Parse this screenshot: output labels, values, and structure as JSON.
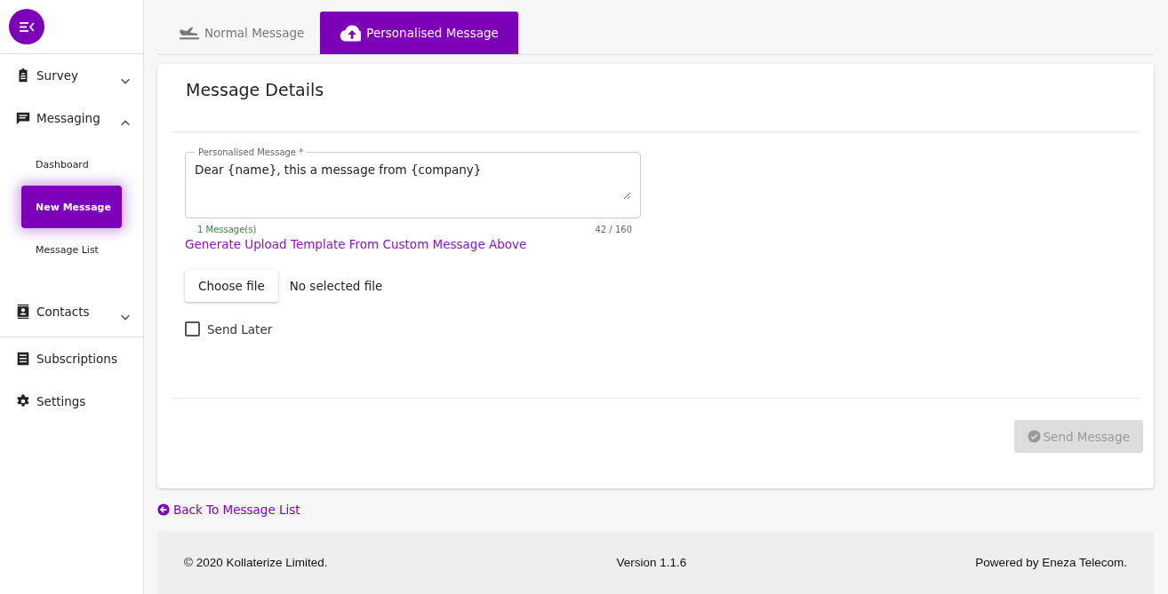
{
  "sidebar": {
    "items": [
      {
        "kind": "group",
        "label": "Survey",
        "expanded": false
      },
      {
        "kind": "group",
        "label": "Messaging",
        "expanded": true,
        "children": [
          {
            "label": "Dashboard",
            "selected": false
          },
          {
            "label": "New Message",
            "selected": true
          },
          {
            "label": "Message List",
            "selected": false
          }
        ]
      },
      {
        "kind": "group",
        "label": "Contacts",
        "expanded": false
      },
      {
        "kind": "divider"
      },
      {
        "kind": "link",
        "label": "Subscriptions"
      },
      {
        "kind": "link",
        "label": "Settings"
      }
    ]
  },
  "tabs": [
    {
      "label": "Normal Message",
      "selected": false
    },
    {
      "label": "Personalised Message",
      "selected": true
    }
  ],
  "card": {
    "title": "Message Details",
    "message_field": {
      "label": "Personalised Message *",
      "value": "Dear {name}, this a message from {company}",
      "helper": "1 Message(s)",
      "counter": "42 / 160"
    },
    "template_link": "Generate Upload Template From Custom Message Above",
    "file_button": "Choose file",
    "file_status": "No selected file",
    "send_later": {
      "label": "Send Later",
      "checked": false
    },
    "send_button": {
      "label": "Send Message",
      "disabled": true
    }
  },
  "back_link": "Back To Message List",
  "footer": {
    "copyright": "© 2020 Kollaterize Limited.",
    "version": "Version 1.1.6",
    "powered_by": "Powered by Eneza Telecom."
  }
}
